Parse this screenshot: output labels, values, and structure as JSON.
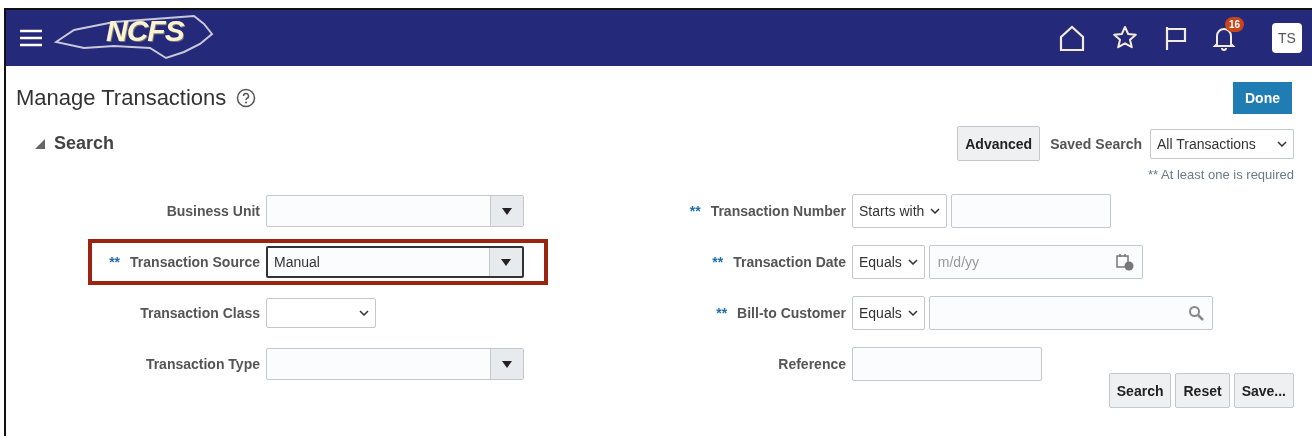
{
  "header": {
    "logo_text": "NCFS",
    "notification_count": "16",
    "avatar": "TS"
  },
  "page": {
    "title": "Manage Transactions",
    "done_button": "Done"
  },
  "search": {
    "title": "Search",
    "expanded": true,
    "advanced_button": "Advanced",
    "saved_search_label": "Saved Search",
    "saved_search_value": "All Transactions",
    "required_note": "** At least one is required",
    "left_fields": [
      {
        "label": "Business Unit",
        "kind": "combo",
        "highlighted": false,
        "focused": false
      },
      {
        "label": "Transaction Source",
        "required_mark": "**",
        "kind": "combo",
        "value": "Manual",
        "highlighted": true,
        "focused": true
      },
      {
        "label": "Transaction Class",
        "kind": "select",
        "highlighted": false,
        "focused": false
      },
      {
        "label": "Transaction Type",
        "kind": "combo",
        "highlighted": false,
        "focused": false
      }
    ],
    "right_fields": [
      {
        "label": "Transaction Number",
        "required_mark": "**",
        "operator": "Starts with",
        "kind": "text"
      },
      {
        "label": "Transaction Date",
        "required_mark": "**",
        "operator": "Equals",
        "kind": "date",
        "placeholder": "m/d/yy"
      },
      {
        "label": "Bill-to Customer",
        "required_mark": "**",
        "operator": "Equals",
        "kind": "lov"
      },
      {
        "label": "Reference",
        "kind": "text"
      }
    ],
    "buttons": [
      "Search",
      "Reset",
      "Save..."
    ]
  }
}
